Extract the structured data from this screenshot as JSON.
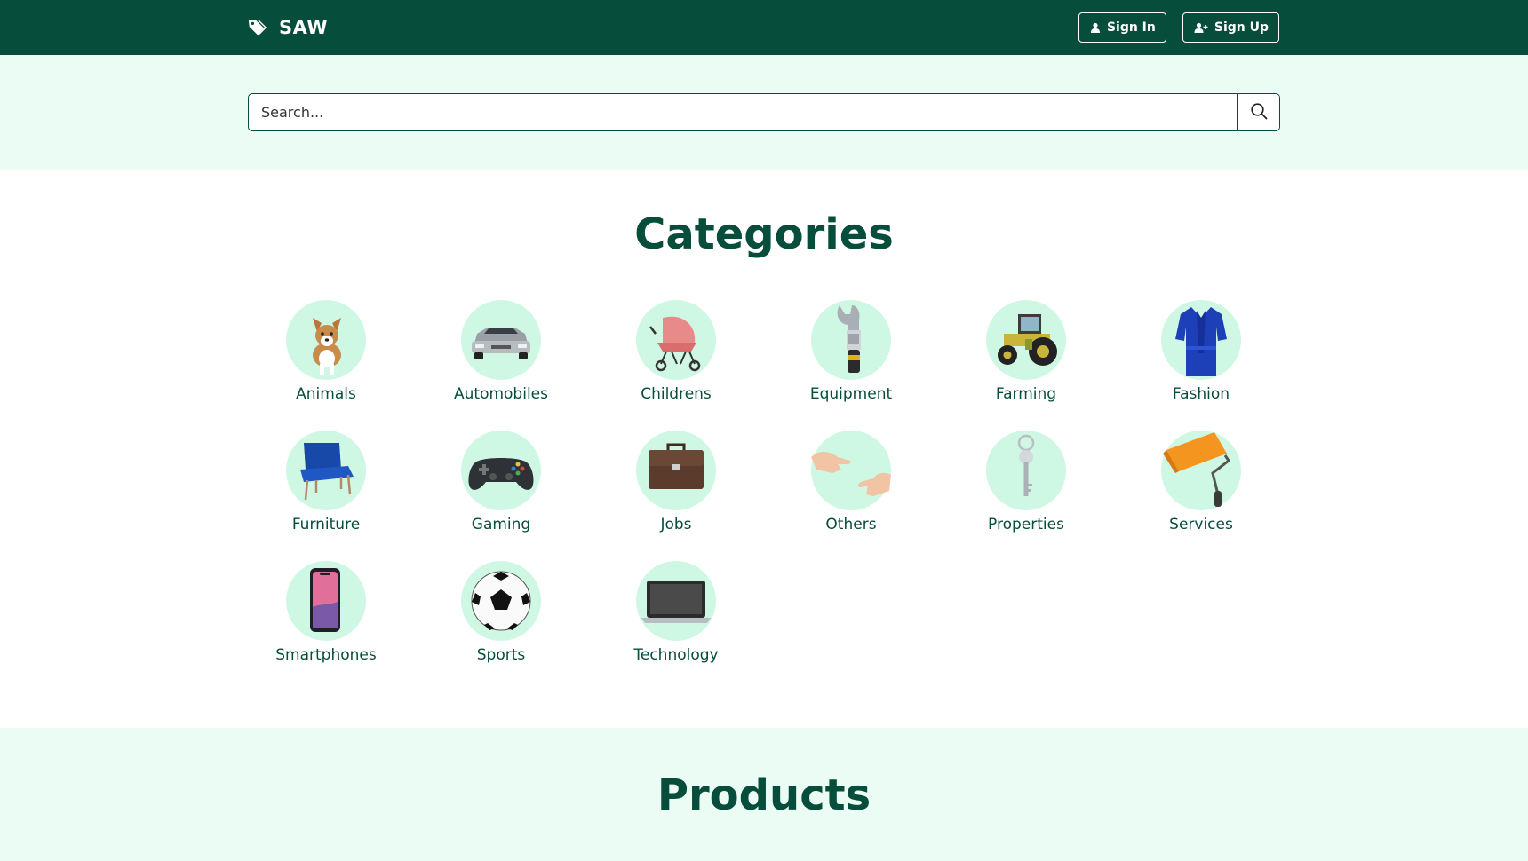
{
  "brand": {
    "name": "SAW"
  },
  "nav": {
    "sign_in": "Sign In",
    "sign_up": "Sign Up"
  },
  "search": {
    "placeholder": "Search..."
  },
  "categories": {
    "title": "Categories",
    "items": [
      {
        "label": "Animals",
        "icon": "dog-icon"
      },
      {
        "label": "Automobiles",
        "icon": "car-icon"
      },
      {
        "label": "Childrens",
        "icon": "stroller-icon"
      },
      {
        "label": "Equipment",
        "icon": "wrench-icon"
      },
      {
        "label": "Farming",
        "icon": "tractor-icon"
      },
      {
        "label": "Fashion",
        "icon": "robe-icon"
      },
      {
        "label": "Furniture",
        "icon": "chair-icon"
      },
      {
        "label": "Gaming",
        "icon": "gamepad-icon"
      },
      {
        "label": "Jobs",
        "icon": "briefcase-icon"
      },
      {
        "label": "Others",
        "icon": "hands-icon"
      },
      {
        "label": "Properties",
        "icon": "key-icon"
      },
      {
        "label": "Services",
        "icon": "paint-roller-icon"
      },
      {
        "label": "Smartphones",
        "icon": "smartphone-icon"
      },
      {
        "label": "Sports",
        "icon": "soccer-ball-icon"
      },
      {
        "label": "Technology",
        "icon": "laptop-icon"
      }
    ]
  },
  "products": {
    "title": "Products"
  },
  "colors": {
    "primary": "#074d3b",
    "band": "#ebfcf4",
    "circle": "#cef7e4"
  }
}
